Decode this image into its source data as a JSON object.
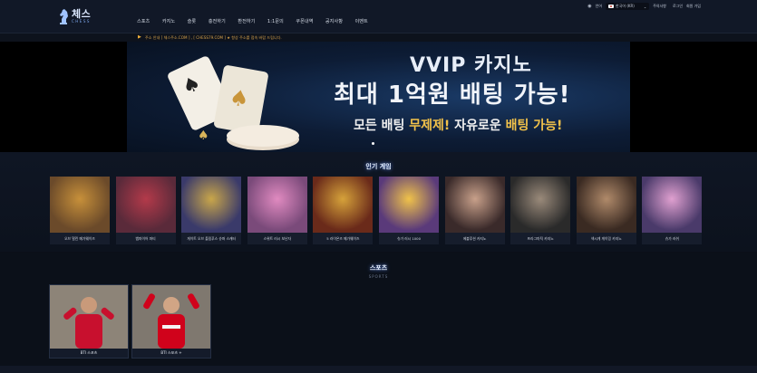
{
  "header": {
    "logo_main": "체스",
    "logo_sub": "CHESS",
    "nav": [
      "스포츠",
      "카지노",
      "슬롯",
      "충전하기",
      "환전하기",
      "1:1문의",
      "쿠폰내역",
      "공지사항",
      "이벤트"
    ],
    "topright": {
      "lang_label": "언어",
      "lang_value": "한국어 (KR)",
      "links": [
        "주의사항",
        "로그인",
        "회원 가입"
      ]
    }
  },
  "notice": {
    "icon": "megaphone-icon",
    "text": "주소 안내 [ 체스주소.COM ] , [ CHESS79.COM ] ★ 항상 주소를 접속 바랍 드립니다."
  },
  "banner": {
    "title1": "VVIP 카지노",
    "title2": "최대 1억원 배팅 가능!",
    "sub_pre": "모든 배팅 ",
    "sub_hl1": "무제제!",
    "sub_mid": " 자유로운 ",
    "sub_hl2": "배팅 가능!"
  },
  "popular": {
    "title": "인기 게임",
    "games": [
      {
        "name": "오브 멀린 메가웨이즈",
        "color": "#6b4a2a",
        "accent": "#c7903a"
      },
      {
        "name": "뱀파이어 파티",
        "color": "#5a2a3a",
        "accent": "#b33a4a"
      },
      {
        "name": "게이트 오브 올림푸스 슈퍼 스캐터",
        "color": "#3a3a6a",
        "accent": "#c9a64a"
      },
      {
        "name": "스위트 러시 보난자",
        "color": "#7a4a7a",
        "accent": "#e08ac0"
      },
      {
        "name": "5 라이온즈 메가웨이즈",
        "color": "#6a2a1a",
        "accent": "#d6a23a"
      },
      {
        "name": "슈가 러시 1000",
        "color": "#5a3a7a",
        "accent": "#f0c24a"
      },
      {
        "name": "에볼루션 카지노",
        "color": "#3a2a2a",
        "accent": "#c8a08a"
      },
      {
        "name": "프라그마틱 카지노",
        "color": "#2a2a2a",
        "accent": "#9a8a7a"
      },
      {
        "name": "섹시게 게이밍 카지노",
        "color": "#3a2a22",
        "accent": "#b08a6a"
      },
      {
        "name": "슈가 러쉬",
        "color": "#4a3a6a",
        "accent": "#e0a0d0"
      },
      {
        "name": "스위",
        "color": "#6a3a5a",
        "accent": "#e07ab0"
      }
    ]
  },
  "sports": {
    "title": "스포츠",
    "sub": "SPORTS",
    "items": [
      {
        "name": "BTI 스포츠",
        "shirt": "#c8102e"
      },
      {
        "name": "BTI 스포츠 +",
        "shirt": "#d0021b"
      }
    ]
  }
}
